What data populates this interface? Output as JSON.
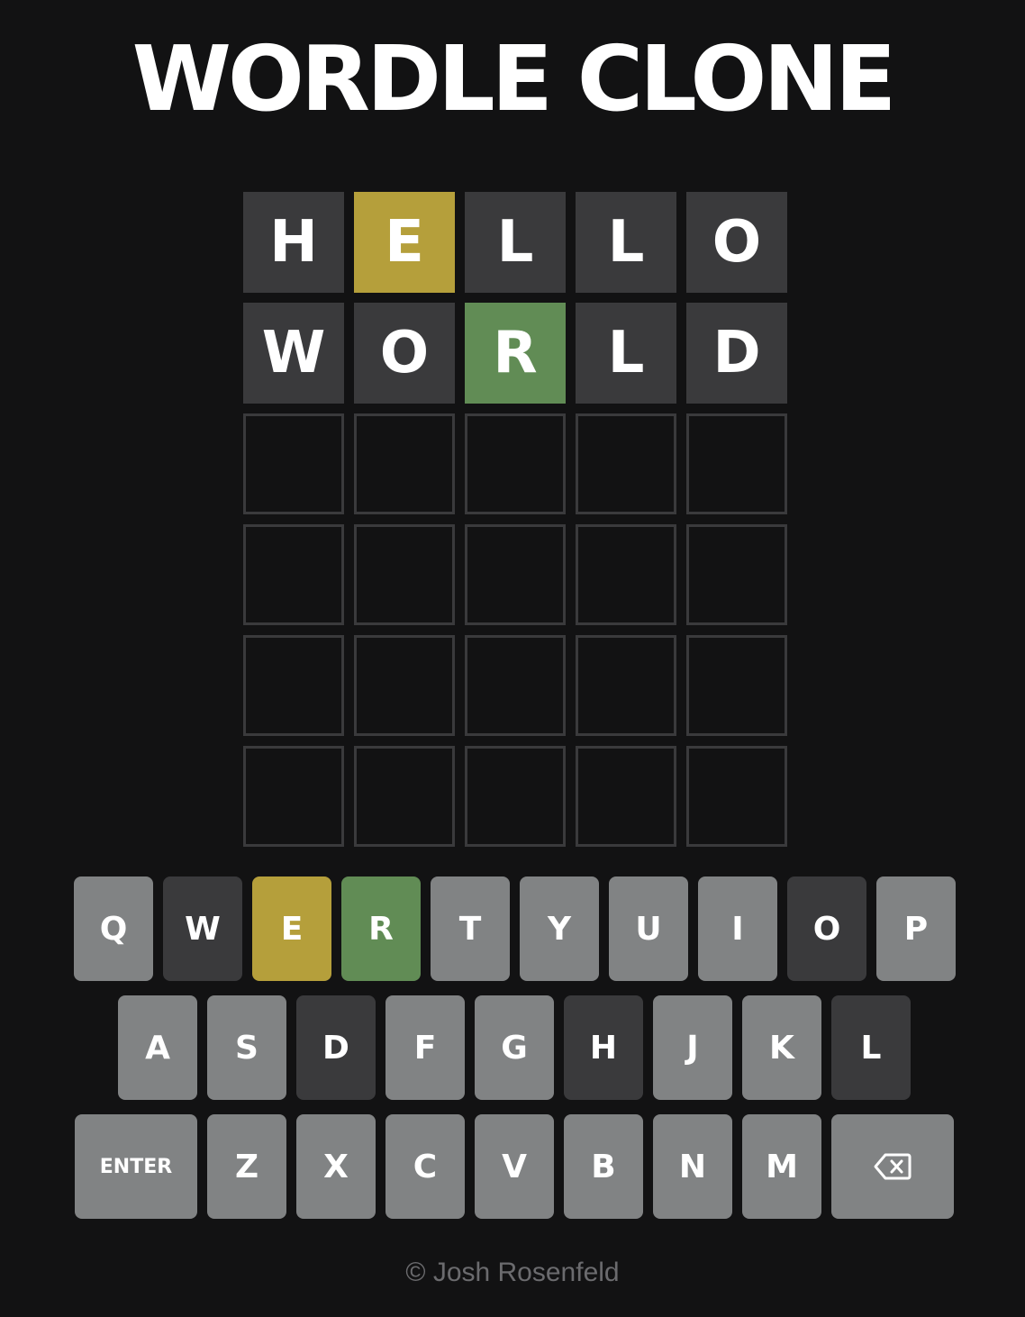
{
  "header": {
    "title": "WORDLE CLONE"
  },
  "colors": {
    "background": "#121213",
    "absent": "#3a3a3c",
    "present": "#b59f3b",
    "correct": "#618c55",
    "unused_key": "#818384",
    "empty_border": "#3a3a3c"
  },
  "board": {
    "rows": [
      [
        {
          "letter": "H",
          "state": "absent"
        },
        {
          "letter": "E",
          "state": "present"
        },
        {
          "letter": "L",
          "state": "absent"
        },
        {
          "letter": "L",
          "state": "absent"
        },
        {
          "letter": "O",
          "state": "absent"
        }
      ],
      [
        {
          "letter": "W",
          "state": "absent"
        },
        {
          "letter": "O",
          "state": "absent"
        },
        {
          "letter": "R",
          "state": "correct"
        },
        {
          "letter": "L",
          "state": "absent"
        },
        {
          "letter": "D",
          "state": "absent"
        }
      ],
      [
        {
          "letter": "",
          "state": "empty"
        },
        {
          "letter": "",
          "state": "empty"
        },
        {
          "letter": "",
          "state": "empty"
        },
        {
          "letter": "",
          "state": "empty"
        },
        {
          "letter": "",
          "state": "empty"
        }
      ],
      [
        {
          "letter": "",
          "state": "empty"
        },
        {
          "letter": "",
          "state": "empty"
        },
        {
          "letter": "",
          "state": "empty"
        },
        {
          "letter": "",
          "state": "empty"
        },
        {
          "letter": "",
          "state": "empty"
        }
      ],
      [
        {
          "letter": "",
          "state": "empty"
        },
        {
          "letter": "",
          "state": "empty"
        },
        {
          "letter": "",
          "state": "empty"
        },
        {
          "letter": "",
          "state": "empty"
        },
        {
          "letter": "",
          "state": "empty"
        }
      ],
      [
        {
          "letter": "",
          "state": "empty"
        },
        {
          "letter": "",
          "state": "empty"
        },
        {
          "letter": "",
          "state": "empty"
        },
        {
          "letter": "",
          "state": "empty"
        },
        {
          "letter": "",
          "state": "empty"
        }
      ]
    ]
  },
  "keyboard": {
    "rows": [
      [
        {
          "label": "Q",
          "state": "unused"
        },
        {
          "label": "W",
          "state": "absent"
        },
        {
          "label": "E",
          "state": "present"
        },
        {
          "label": "R",
          "state": "correct"
        },
        {
          "label": "T",
          "state": "unused"
        },
        {
          "label": "Y",
          "state": "unused"
        },
        {
          "label": "U",
          "state": "unused"
        },
        {
          "label": "I",
          "state": "unused"
        },
        {
          "label": "O",
          "state": "absent"
        },
        {
          "label": "P",
          "state": "unused"
        }
      ],
      [
        {
          "label": "A",
          "state": "unused"
        },
        {
          "label": "S",
          "state": "unused"
        },
        {
          "label": "D",
          "state": "absent"
        },
        {
          "label": "F",
          "state": "unused"
        },
        {
          "label": "G",
          "state": "unused"
        },
        {
          "label": "H",
          "state": "absent"
        },
        {
          "label": "J",
          "state": "unused"
        },
        {
          "label": "K",
          "state": "unused"
        },
        {
          "label": "L",
          "state": "absent"
        }
      ],
      [
        {
          "label": "ENTER",
          "state": "unused",
          "kind": "enter"
        },
        {
          "label": "Z",
          "state": "unused"
        },
        {
          "label": "X",
          "state": "unused"
        },
        {
          "label": "C",
          "state": "unused"
        },
        {
          "label": "V",
          "state": "unused"
        },
        {
          "label": "B",
          "state": "unused"
        },
        {
          "label": "N",
          "state": "unused"
        },
        {
          "label": "M",
          "state": "unused"
        },
        {
          "label": "",
          "state": "unused",
          "kind": "backspace",
          "icon": "backspace-icon"
        }
      ]
    ]
  },
  "footer": {
    "text": "© Josh Rosenfeld"
  }
}
